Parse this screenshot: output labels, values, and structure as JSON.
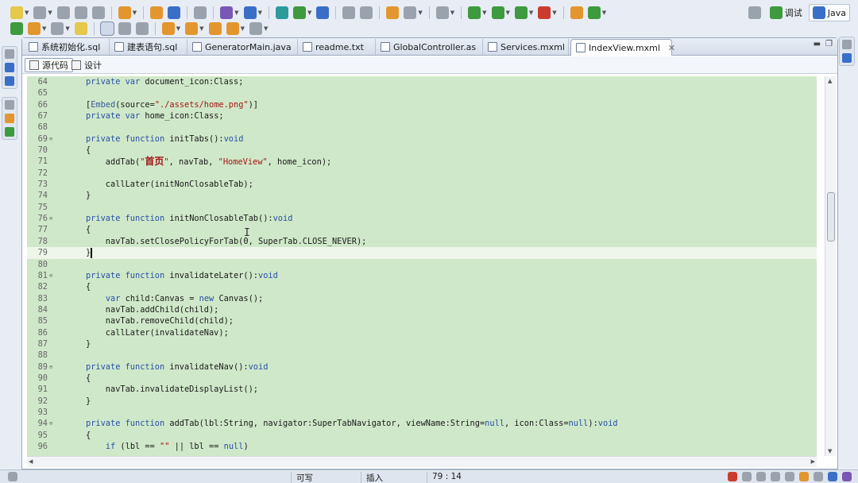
{
  "toolbar": {
    "row1_icons": [
      "new-icon",
      "new-project-icon",
      "save-icon",
      "save-all-icon",
      "print-icon",
      "new-wizard-icon",
      "package-icon",
      "class-icon",
      "open-type-icon",
      "annotate-icon",
      "search-icon",
      "run-debug-config-icon",
      "globe-icon",
      "back-history-icon",
      "forward-history-icon",
      "monitor-icon",
      "screen-icon",
      "run-config-icon",
      "run-icon",
      "coverage-icon",
      "external-tools-icon",
      "gear-icon",
      "refresh-icon"
    ],
    "row2_icons": [
      "open-folder-icon",
      "open-file-icon",
      "wrench-icon",
      "folder-open-icon",
      "toggle-mark-icon",
      "block-select-icon",
      "whitespace-icon",
      "next-annotation-icon",
      "prev-annotation-icon",
      "last-edit-icon",
      "back-icon",
      "forward-icon"
    ]
  },
  "perspective": {
    "debug_label": "调试",
    "java_label": "Java"
  },
  "tabs": [
    {
      "label": "系统初始化.sql"
    },
    {
      "label": "建表语句.sql"
    },
    {
      "label": "GeneratorMain.java"
    },
    {
      "label": "readme.txt"
    },
    {
      "label": "GlobalController.as"
    },
    {
      "label": "Services.mxml"
    },
    {
      "label": "IndexView.mxml",
      "active": true
    }
  ],
  "modes": {
    "source_label": "源代码",
    "design_label": "设计"
  },
  "code_lines": [
    {
      "n": "64",
      "fold": "",
      "tokens": [
        [
          "kw",
          "private "
        ],
        [
          "kw",
          "var "
        ],
        [
          "",
          "document_icon:Class;"
        ]
      ]
    },
    {
      "n": "65",
      "fold": "",
      "tokens": []
    },
    {
      "n": "66",
      "fold": "",
      "tokens": [
        [
          "",
          "["
        ],
        [
          "meta",
          "Embed"
        ],
        [
          "",
          "(source="
        ],
        [
          "str",
          "\"./assets/home.png\""
        ],
        [
          "",
          ")]"
        ]
      ]
    },
    {
      "n": "67",
      "fold": "",
      "tokens": [
        [
          "kw",
          "private "
        ],
        [
          "kw",
          "var "
        ],
        [
          "",
          "home_icon:Class;"
        ]
      ]
    },
    {
      "n": "68",
      "fold": "",
      "tokens": []
    },
    {
      "n": "69",
      "fold": "⊖",
      "tokens": [
        [
          "kw",
          "private "
        ],
        [
          "kw",
          "function "
        ],
        [
          "",
          "initTabs():"
        ],
        [
          "typ",
          "void"
        ]
      ]
    },
    {
      "n": "70",
      "fold": "",
      "tokens": [
        [
          "",
          "{"
        ]
      ]
    },
    {
      "n": "71",
      "fold": "",
      "tokens": [
        [
          "",
          "    addTab("
        ],
        [
          "str",
          "\""
        ],
        [
          "zh",
          "首页"
        ],
        [
          "str",
          "\""
        ],
        [
          "",
          ", navTab, "
        ],
        [
          "str",
          "\"HomeView\""
        ],
        [
          "",
          ", home_icon);"
        ]
      ]
    },
    {
      "n": "72",
      "fold": "",
      "tokens": []
    },
    {
      "n": "73",
      "fold": "",
      "tokens": [
        [
          "",
          "    callLater(initNonClosableTab);"
        ]
      ]
    },
    {
      "n": "74",
      "fold": "",
      "tokens": [
        [
          "",
          "}"
        ]
      ]
    },
    {
      "n": "75",
      "fold": "",
      "tokens": []
    },
    {
      "n": "76",
      "fold": "⊖",
      "tokens": [
        [
          "kw",
          "private "
        ],
        [
          "kw",
          "function "
        ],
        [
          "",
          "initNonClosableTab():"
        ],
        [
          "typ",
          "void"
        ]
      ]
    },
    {
      "n": "77",
      "fold": "",
      "tokens": [
        [
          "",
          "{"
        ]
      ]
    },
    {
      "n": "78",
      "fold": "",
      "tokens": [
        [
          "",
          "    navTab.setClosePolicyForTab(0, SuperTab.CLOSE_NEVER);"
        ]
      ]
    },
    {
      "n": "79",
      "fold": "",
      "tokens": [
        [
          "",
          "}"
        ]
      ],
      "current": true
    },
    {
      "n": "80",
      "fold": "",
      "tokens": []
    },
    {
      "n": "81",
      "fold": "⊖",
      "tokens": [
        [
          "kw",
          "private "
        ],
        [
          "kw",
          "function "
        ],
        [
          "",
          "invalidateLater():"
        ],
        [
          "typ",
          "void"
        ]
      ]
    },
    {
      "n": "82",
      "fold": "",
      "tokens": [
        [
          "",
          "{"
        ]
      ]
    },
    {
      "n": "83",
      "fold": "",
      "tokens": [
        [
          "",
          "    "
        ],
        [
          "kw",
          "var "
        ],
        [
          "",
          "child:Canvas = "
        ],
        [
          "kw",
          "new "
        ],
        [
          "",
          "Canvas();"
        ]
      ]
    },
    {
      "n": "84",
      "fold": "",
      "tokens": [
        [
          "",
          "    navTab.addChild(child);"
        ]
      ]
    },
    {
      "n": "85",
      "fold": "",
      "tokens": [
        [
          "",
          "    navTab.removeChild(child);"
        ]
      ]
    },
    {
      "n": "86",
      "fold": "",
      "tokens": [
        [
          "",
          "    callLater(invalidateNav);"
        ]
      ]
    },
    {
      "n": "87",
      "fold": "",
      "tokens": [
        [
          "",
          "}"
        ]
      ]
    },
    {
      "n": "88",
      "fold": "",
      "tokens": []
    },
    {
      "n": "89",
      "fold": "⊖",
      "tokens": [
        [
          "kw",
          "private "
        ],
        [
          "kw",
          "function "
        ],
        [
          "",
          "invalidateNav():"
        ],
        [
          "typ",
          "void"
        ]
      ]
    },
    {
      "n": "90",
      "fold": "",
      "tokens": [
        [
          "",
          "{"
        ]
      ]
    },
    {
      "n": "91",
      "fold": "",
      "tokens": [
        [
          "",
          "    navTab.invalidateDisplayList();"
        ]
      ]
    },
    {
      "n": "92",
      "fold": "",
      "tokens": [
        [
          "",
          "}"
        ]
      ]
    },
    {
      "n": "93",
      "fold": "",
      "tokens": []
    },
    {
      "n": "94",
      "fold": "⊖",
      "tokens": [
        [
          "kw",
          "private "
        ],
        [
          "kw",
          "function "
        ],
        [
          "",
          "addTab(lbl:String, navigator:SuperTabNavigator, viewName:String="
        ],
        [
          "kw",
          "null"
        ],
        [
          "",
          ", icon:Class="
        ],
        [
          "kw",
          "null"
        ],
        [
          "",
          "):"
        ],
        [
          "typ",
          "void"
        ]
      ]
    },
    {
      "n": "95",
      "fold": "",
      "tokens": [
        [
          "",
          "{"
        ]
      ]
    },
    {
      "n": "96",
      "fold": "",
      "tokens": [
        [
          "",
          "    "
        ],
        [
          "kw",
          "if "
        ],
        [
          "",
          "(lbl == "
        ],
        [
          "str",
          "\"\""
        ],
        [
          "",
          " || lbl == "
        ],
        [
          "kw",
          "null"
        ],
        [
          "",
          ")"
        ]
      ]
    }
  ],
  "status": {
    "writable": "可写",
    "insert_mode": "插入",
    "cursor_pos": "79 : 14"
  },
  "colors": {
    "code_background": "#cfe8c9",
    "keyword": "#2a4fa8",
    "string": "#a31515"
  }
}
